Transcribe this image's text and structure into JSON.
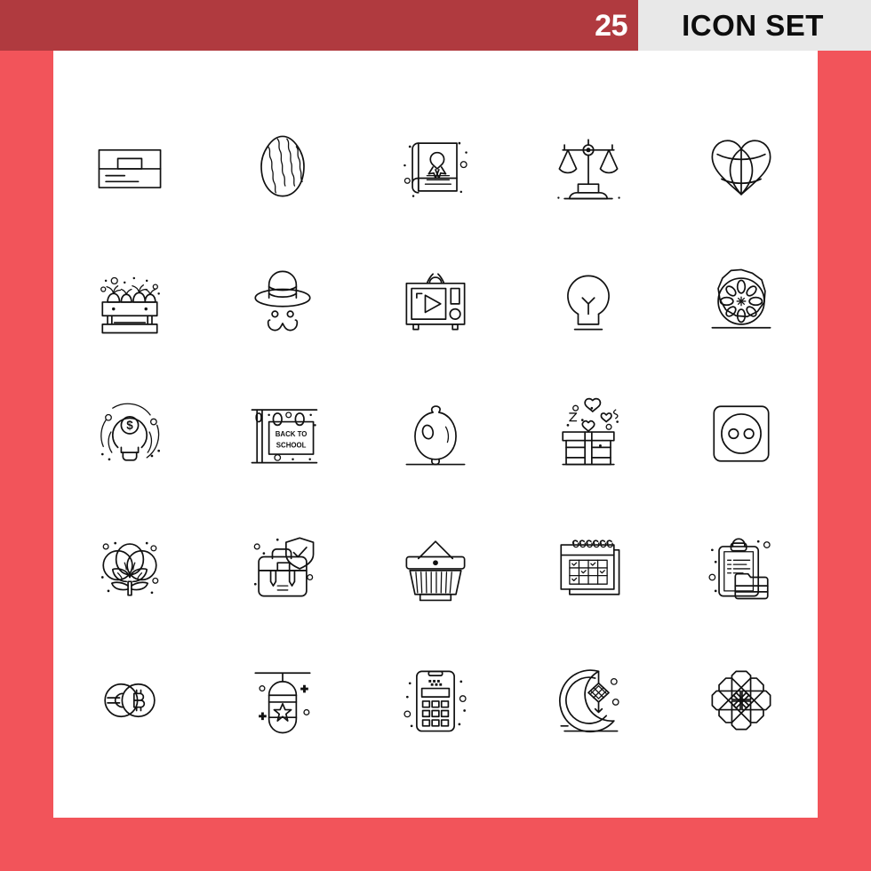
{
  "header": {
    "count": "25",
    "title": "ICON SET",
    "bar_color": "#b03a3f",
    "title_block_color": "#e8e8e8",
    "count_color": "#ffffff",
    "title_color": "#0d0d0d"
  },
  "frame": {
    "border_color": "#f2545a",
    "canvas_color": "#ffffff"
  },
  "grid": {
    "columns": 5,
    "rows": 5,
    "total": 25
  },
  "icons": [
    {
      "name": "id-card-icon",
      "label": "Id Card"
    },
    {
      "name": "easter-egg-icon",
      "label": "Easter Egg"
    },
    {
      "name": "awareness-book-icon",
      "label": "Awareness Book"
    },
    {
      "name": "justice-scales-icon",
      "label": "Justice Scales"
    },
    {
      "name": "globe-heart-icon",
      "label": "Globe Heart"
    },
    {
      "name": "vegetable-crate-icon",
      "label": "Vegetable Crate"
    },
    {
      "name": "hat-mustache-icon",
      "label": "Hat Mustache"
    },
    {
      "name": "retro-tv-icon",
      "label": "Retro Tv"
    },
    {
      "name": "light-bulb-icon",
      "label": "Light Bulb"
    },
    {
      "name": "cucumber-slice-icon",
      "label": "Cucumber Slice"
    },
    {
      "name": "business-idea-icon",
      "label": "Business Idea"
    },
    {
      "name": "back-to-school-sign-icon",
      "label": "Back To School Sign"
    },
    {
      "name": "lemon-icon",
      "label": "Lemon"
    },
    {
      "name": "love-gift-icon",
      "label": "Love Gift"
    },
    {
      "name": "power-socket-icon",
      "label": "Power Socket"
    },
    {
      "name": "cotton-flower-icon",
      "label": "Cotton Flower"
    },
    {
      "name": "secure-briefcase-icon",
      "label": "Secure Briefcase"
    },
    {
      "name": "shopping-basket-icon",
      "label": "Shopping Basket"
    },
    {
      "name": "calendar-check-icon",
      "label": "Calendar Check"
    },
    {
      "name": "clipboard-folder-icon",
      "label": "Clipboard Folder"
    },
    {
      "name": "euro-bitcoin-icon",
      "label": "Euro Bitcoin"
    },
    {
      "name": "hanging-lantern-icon",
      "label": "Hanging Lantern"
    },
    {
      "name": "calculator-icon",
      "label": "Calculator"
    },
    {
      "name": "moon-ketupat-icon",
      "label": "Moon Ketupat"
    },
    {
      "name": "islamic-ornament-icon",
      "label": "Islamic Ornament"
    }
  ],
  "sign": {
    "line1": "BACK TO",
    "line2": "SCHOOL"
  },
  "glyphs": {
    "dollar": "$",
    "bitcoin": "Ƀ",
    "euro_bar": "="
  }
}
